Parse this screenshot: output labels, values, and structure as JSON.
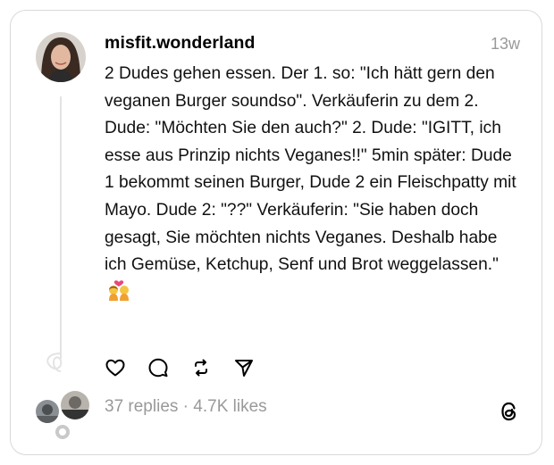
{
  "post": {
    "username": "misfit.wonderland",
    "time": "13w",
    "text": "2 Dudes gehen essen. Der 1. so: \"Ich hätt gern den veganen Burger soundso\". Verkäuferin zu dem 2. Dude: \"Möchten Sie den auch?\" 2. Dude: \"IGITT, ich esse aus Prinzip nichts Veganes!!\" 5min später: Dude 1 bekommt seinen Burger, Dude 2 ein Fleischpatty mit Mayo. Dude 2: \"??\" Verkäuferin: \"Sie haben doch gesagt, Sie möchten nichts Veganes. Deshalb habe ich Gemüse, Ketchup, Senf und Brot weggelassen.\"",
    "emoji": "couple-with-heart-emoji"
  },
  "actions": [
    "heart-icon",
    "comment-icon",
    "repost-icon",
    "share-icon"
  ],
  "stats": {
    "replies": "37 replies",
    "separator": " · ",
    "likes": "4.7K likes"
  },
  "colors": {
    "muted": "#999999",
    "border": "#d9d9d9"
  }
}
